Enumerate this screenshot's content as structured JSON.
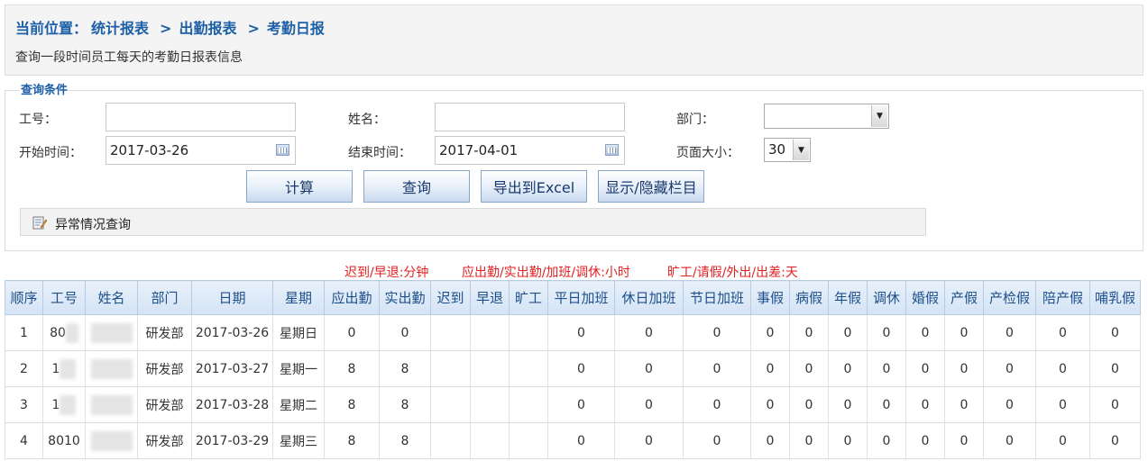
{
  "header": {
    "breadcrumb_prefix": "当前位置：",
    "crumbs": [
      "统计报表",
      "出勤报表",
      "考勤日报"
    ],
    "separator": ">",
    "subtitle": "查询一段时间员工每天的考勤日报表信息"
  },
  "query": {
    "legend": "查询条件",
    "employee_no_label": "工号：",
    "employee_no_value": "",
    "name_label": "姓名：",
    "name_value": "",
    "dept_label": "部门：",
    "dept_value": "",
    "start_label": "开始时间：",
    "start_value": "2017-03-26",
    "end_label": "结束时间：",
    "end_value": "2017-04-01",
    "pagesize_label": "页面大小：",
    "pagesize_value": "30",
    "buttons": {
      "calc": "计算",
      "search": "查询",
      "export": "导出到Excel",
      "toggle_cols": "显示/隐藏栏目"
    },
    "anomaly_label": "异常情况查询"
  },
  "legend": {
    "minutes": "迟到/早退:分钟",
    "hours": "应出勤/实出勤/加班/调休:小时",
    "days": "旷工/请假/外出/出差:天"
  },
  "table": {
    "columns": [
      "顺序",
      "工号",
      "姓名",
      "部门",
      "日期",
      "星期",
      "应出勤",
      "实出勤",
      "迟到",
      "早退",
      "旷工",
      "平日加班",
      "休日加班",
      "节日加班",
      "事假",
      "病假",
      "年假",
      "调休",
      "婚假",
      "产假",
      "产检假",
      "陪产假",
      "哺乳假"
    ],
    "rows": [
      [
        "1",
        "80",
        "",
        "研发部",
        "2017-03-26",
        "星期日",
        "0",
        "0",
        "",
        "",
        "",
        "0",
        "0",
        "0",
        "0",
        "0",
        "0",
        "0",
        "0",
        "0",
        "0",
        "0",
        "0"
      ],
      [
        "2",
        "1",
        "",
        "研发部",
        "2017-03-27",
        "星期一",
        "8",
        "8",
        "",
        "",
        "",
        "0",
        "0",
        "0",
        "0",
        "0",
        "0",
        "0",
        "0",
        "0",
        "0",
        "0",
        "0"
      ],
      [
        "3",
        "1",
        "",
        "研发部",
        "2017-03-28",
        "星期二",
        "8",
        "8",
        "",
        "",
        "",
        "0",
        "0",
        "0",
        "0",
        "0",
        "0",
        "0",
        "0",
        "0",
        "0",
        "0",
        "0"
      ],
      [
        "4",
        "8010",
        "",
        "研发部",
        "2017-03-29",
        "星期三",
        "8",
        "8",
        "",
        "",
        "",
        "0",
        "0",
        "0",
        "0",
        "0",
        "0",
        "0",
        "0",
        "0",
        "0",
        "0",
        "0"
      ]
    ]
  },
  "colors": {
    "header_text": "#1d4f8a",
    "legend_red": "#e02020",
    "breadcrumb": "#1d5fa6"
  }
}
